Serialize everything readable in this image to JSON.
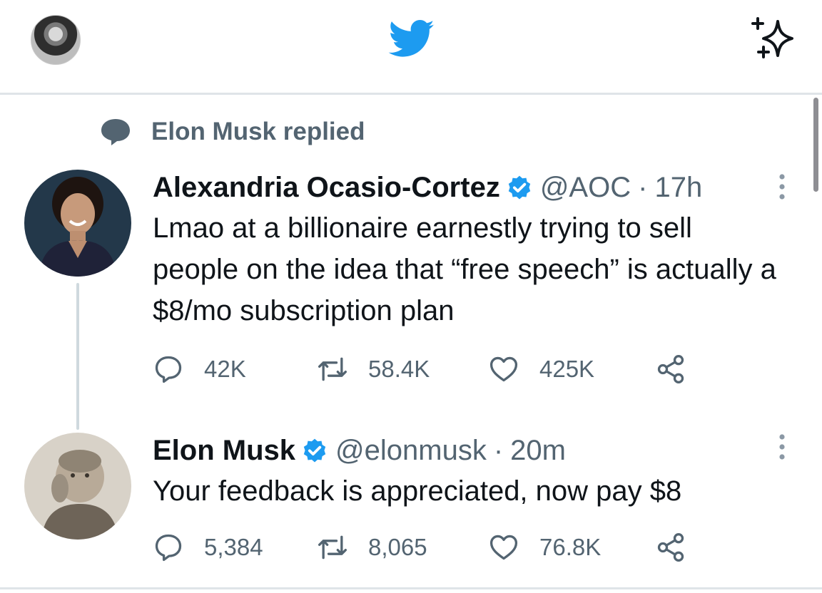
{
  "topbar": {
    "profile_avatar": "user-avatar",
    "logo_icon": "twitter-bird-icon",
    "sparkle_icon": "sparkle-icon"
  },
  "social_context": {
    "label": "Elon Musk replied",
    "icon": "speech-bubble-icon"
  },
  "tweets": [
    {
      "name": "Alexandria Ocasio-Cortez",
      "handle": "@AOC",
      "separator": "·",
      "time": "17h",
      "text": "Lmao at a billionaire earnestly trying to sell people on the idea that “free speech” is actually a $8/mo subscription plan",
      "replies": "42K",
      "retweets": "58.4K",
      "likes": "425K"
    },
    {
      "name": "Elon Musk",
      "handle": "@elonmusk",
      "separator": "·",
      "time": "20m",
      "text": "Your feedback is appreciated, now pay $8",
      "replies": "5,384",
      "retweets": "8,065",
      "likes": "76.8K"
    }
  ],
  "colors": {
    "brand": "#1d9bf0",
    "secondary_text": "#536471",
    "primary_text": "#0f1419",
    "divider": "#dfe4e8"
  }
}
